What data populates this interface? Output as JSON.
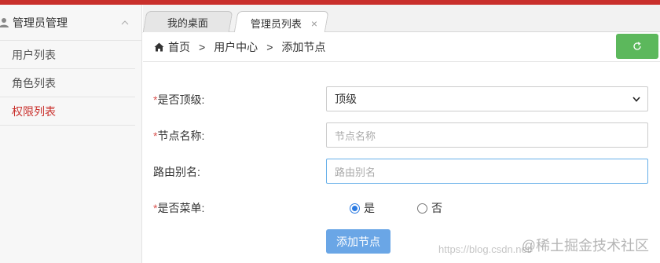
{
  "sidebar": {
    "group_title": "管理员管理",
    "items": [
      {
        "label": "用户列表",
        "active": false
      },
      {
        "label": "角色列表",
        "active": false
      },
      {
        "label": "权限列表",
        "active": true
      }
    ]
  },
  "tabs": [
    {
      "label": "我的桌面",
      "active": false
    },
    {
      "label": "管理员列表",
      "active": true,
      "close": "×"
    }
  ],
  "breadcrumb": {
    "items": [
      "首页",
      "用户中心",
      "添加节点"
    ],
    "separator": ">"
  },
  "form": {
    "is_top_level": {
      "label": "是否顶级:",
      "required_mark": "*",
      "value": "顶级"
    },
    "node_name": {
      "label": "节点名称:",
      "required_mark": "*",
      "placeholder": "节点名称",
      "value": ""
    },
    "route_alias": {
      "label": "路由别名:",
      "placeholder": "路由别名",
      "value": ""
    },
    "is_menu": {
      "label": "是否菜单:",
      "required_mark": "*",
      "options": [
        "是",
        "否"
      ],
      "selected": "是"
    },
    "submit_label": "添加节点"
  },
  "watermark": {
    "url_text": "https://blog.csdn.net/",
    "brand_text": "@稀土掘金技术社区"
  },
  "colors": {
    "brand_red": "#c9302c",
    "refresh_green": "#5cb85c",
    "submit_blue": "#6aa6e6",
    "radio_blue": "#2a7ae2"
  }
}
